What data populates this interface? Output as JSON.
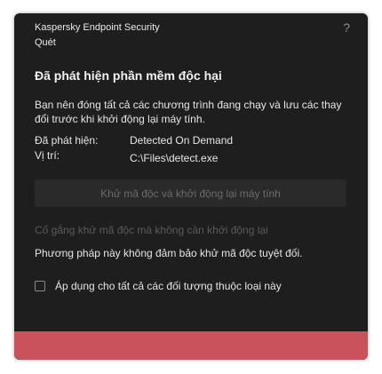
{
  "window": {
    "app_name": "Kaspersky Endpoint Security",
    "subtitle": "Quét",
    "help_label": "?"
  },
  "alert": {
    "heading": "Đã phát hiện phần mềm độc hại",
    "message": "Bạn nên đóng tất cả các chương trình đang chạy và lưu các thay đổi trước khi khởi động lại máy tính.",
    "detected_label": "Đã phát hiện:",
    "detected_value": "Detected On Demand",
    "location_label": "Vị trí:",
    "location_value": "C:\\Files\\detect.exe"
  },
  "actions": {
    "disinfect_restart_label": "Khử mã độc và khởi động lại máy tính",
    "disinfect_no_restart_label": "Cố gắng khử mã độc mà không cần khởi động lại",
    "warning": "Phương pháp này không đảm bảo khử mã độc tuyệt đối.",
    "apply_all_label": "Áp dụng cho tất cả các đối tượng thuộc loại này",
    "apply_all_checked": false
  },
  "colors": {
    "dialog_background": "#1e1e1f",
    "footer_accent": "#c8535c"
  }
}
